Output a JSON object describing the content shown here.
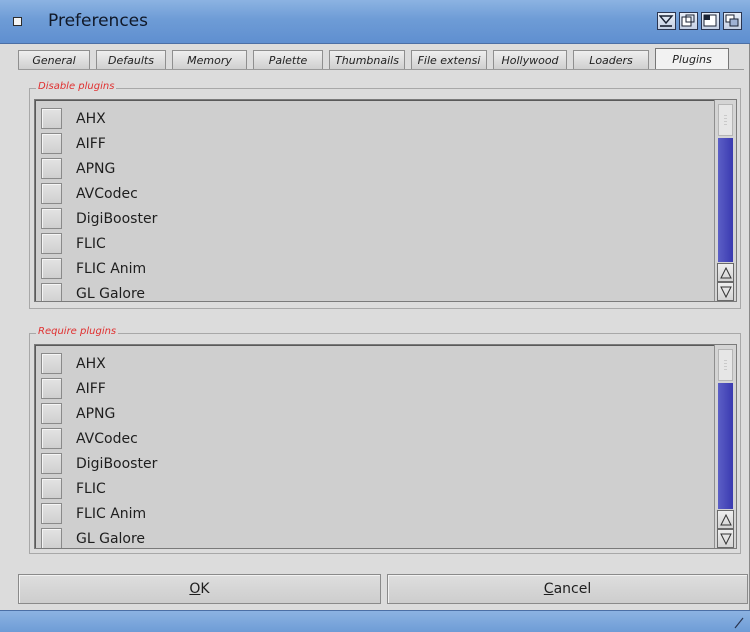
{
  "window": {
    "title": "Preferences",
    "colors": {
      "titlebar": "#6e9cd6",
      "scroll_fill": "#4a4ab8",
      "group_label": "#e03030"
    }
  },
  "tabs": [
    {
      "label": "General"
    },
    {
      "label": "Defaults"
    },
    {
      "label": "Memory"
    },
    {
      "label": "Palette"
    },
    {
      "label": "Thumbnails"
    },
    {
      "label": "File extensi"
    },
    {
      "label": "Hollywood"
    },
    {
      "label": "Loaders"
    },
    {
      "label": "Plugins",
      "active": true
    }
  ],
  "disable_plugins": {
    "label": "Disable plugins",
    "items": [
      "AHX",
      "AIFF",
      "APNG",
      "AVCodec",
      "DigiBooster",
      "FLIC",
      "FLIC Anim",
      "GL Galore"
    ]
  },
  "require_plugins": {
    "label": "Require plugins",
    "items": [
      "AHX",
      "AIFF",
      "APNG",
      "AVCodec",
      "DigiBooster",
      "FLIC",
      "FLIC Anim",
      "GL Galore"
    ]
  },
  "buttons": {
    "ok_mnemonic": "O",
    "ok_rest": "K",
    "cancel_mnemonic": "C",
    "cancel_rest": "ancel"
  }
}
